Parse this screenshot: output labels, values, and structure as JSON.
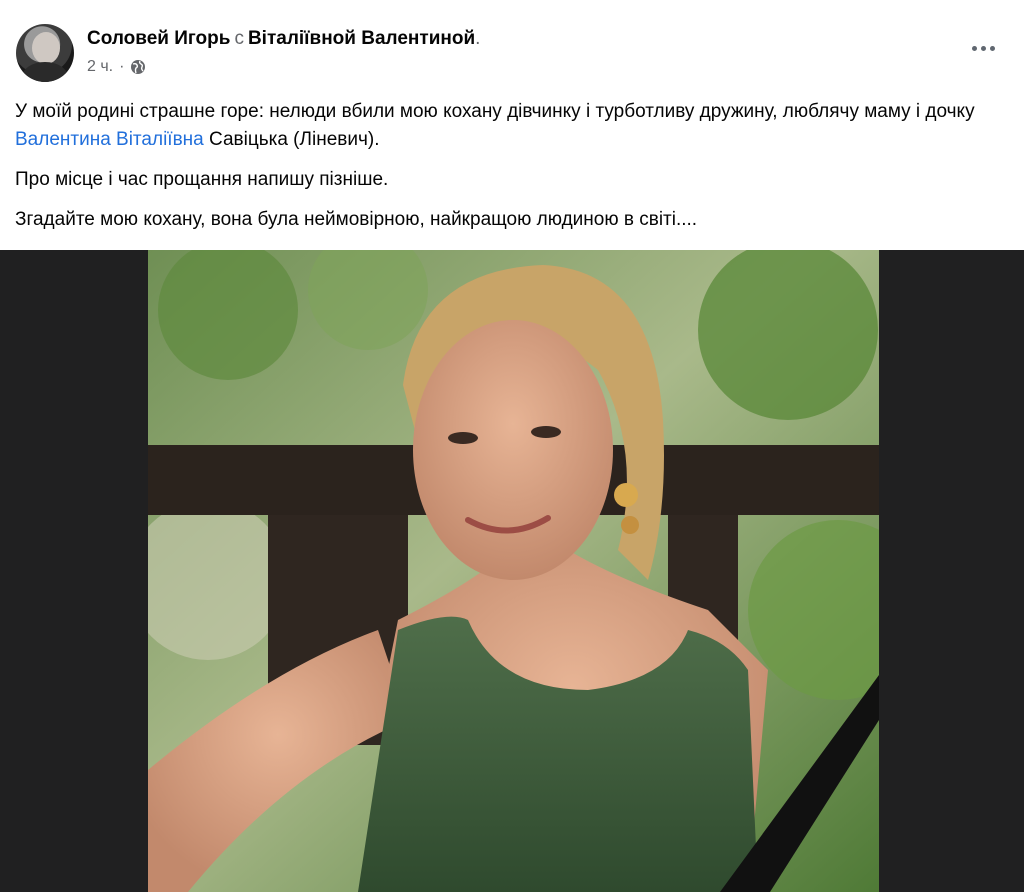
{
  "post": {
    "author": "Соловей Игорь",
    "with_word": "с",
    "tagged_friend": "Віталіївной Валентиной",
    "trailing_dot": ".",
    "time": "2 ч.",
    "separator": "·",
    "audience_icon": "globe-icon",
    "more_icon": "more-options-icon"
  },
  "text": {
    "p1_before": "У моїй родині страшне горе: нелюди вбили мою кохану дівчинку і турботливу дружину, люблячу маму і дочку ",
    "p1_tag": "Валентина Віталіївна",
    "p1_after": " Савіцька (Ліневич).",
    "p2": "Про місце і час прощання напишу пізніше.",
    "p3": "Згадайте мою кохану, вона була неймовірною, найкращою людиною в світі...."
  },
  "colors": {
    "link": "#216fdb",
    "secondary_text": "#65676b",
    "photo_backdrop": "#202021",
    "ribbon": "#111111"
  }
}
